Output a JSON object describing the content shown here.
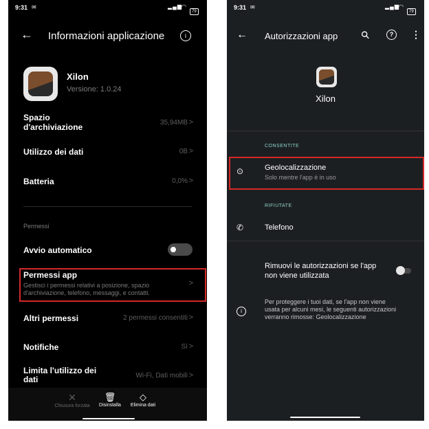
{
  "left": {
    "status_time": "9:31",
    "battery": "79",
    "header": {
      "back": "←",
      "title": "Informazioni applicazione",
      "info": "i"
    },
    "app": {
      "name": "Xilon",
      "version": "Versione: 1.0.24"
    },
    "rows": {
      "storage": {
        "label_line1": "Spazio",
        "label_line2": "d'archiviazione",
        "value": "35,94MB"
      },
      "data_usage": {
        "label": "Utilizzo dei dati",
        "value": "0B"
      },
      "battery": {
        "label": "Batteria",
        "value": "0,0%"
      }
    },
    "section_title": "Permessi",
    "autostart": {
      "label": "Avvio automatico",
      "enabled": false
    },
    "app_permissions": {
      "label": "Permessi app",
      "desc_line1": "Gestisci i permessi relativi a posizione, spazio",
      "desc_line2": "d'archiviazione, telefono, messaggi, e contatti."
    },
    "other_permissions": {
      "label": "Altri permessi",
      "value": "2 permessi consentiti"
    },
    "notifications": {
      "label": "Notifiche",
      "value": "Sì"
    },
    "limit_data": {
      "label_line1": "Limita l'utilizzo dei",
      "label_line2": "dati",
      "value": "Wi-Fi, Dati mobili"
    },
    "bottom_bar": {
      "force_stop": "Chiusura forzata",
      "uninstall": "Disinstalla",
      "clear_data": "Elimina dati"
    },
    "chevron": ">"
  },
  "right": {
    "status_time": "9:31",
    "battery": "79",
    "header": {
      "back": "←",
      "title": "Autorizzazioni app",
      "search": "⚲",
      "help": "?",
      "more": "⋮"
    },
    "app_name": "Xilon",
    "allowed_title": "CONSENTITE",
    "location": {
      "label": "Geolocalizzazione",
      "desc": "Solo mentre l'app è in uso"
    },
    "denied_title": "RIFIUTATE",
    "phone": {
      "label": "Telefono"
    },
    "remove_permissions": {
      "label_line1": "Rimuovi le autorizzazioni se l'app",
      "label_line2": "non viene utilizzata",
      "enabled": false
    },
    "info_text": {
      "line1": "Per proteggere i tuoi dati, se l'app non viene",
      "line2": "usata per alcuni mesi, le seguenti autorizzazioni",
      "line3": "verranno rimosse: Geolocalizzazione"
    }
  },
  "colors": {
    "highlight": "#d62828",
    "toggle_off": "#4a4a4a",
    "accent_teal": "#8fd4cb"
  }
}
